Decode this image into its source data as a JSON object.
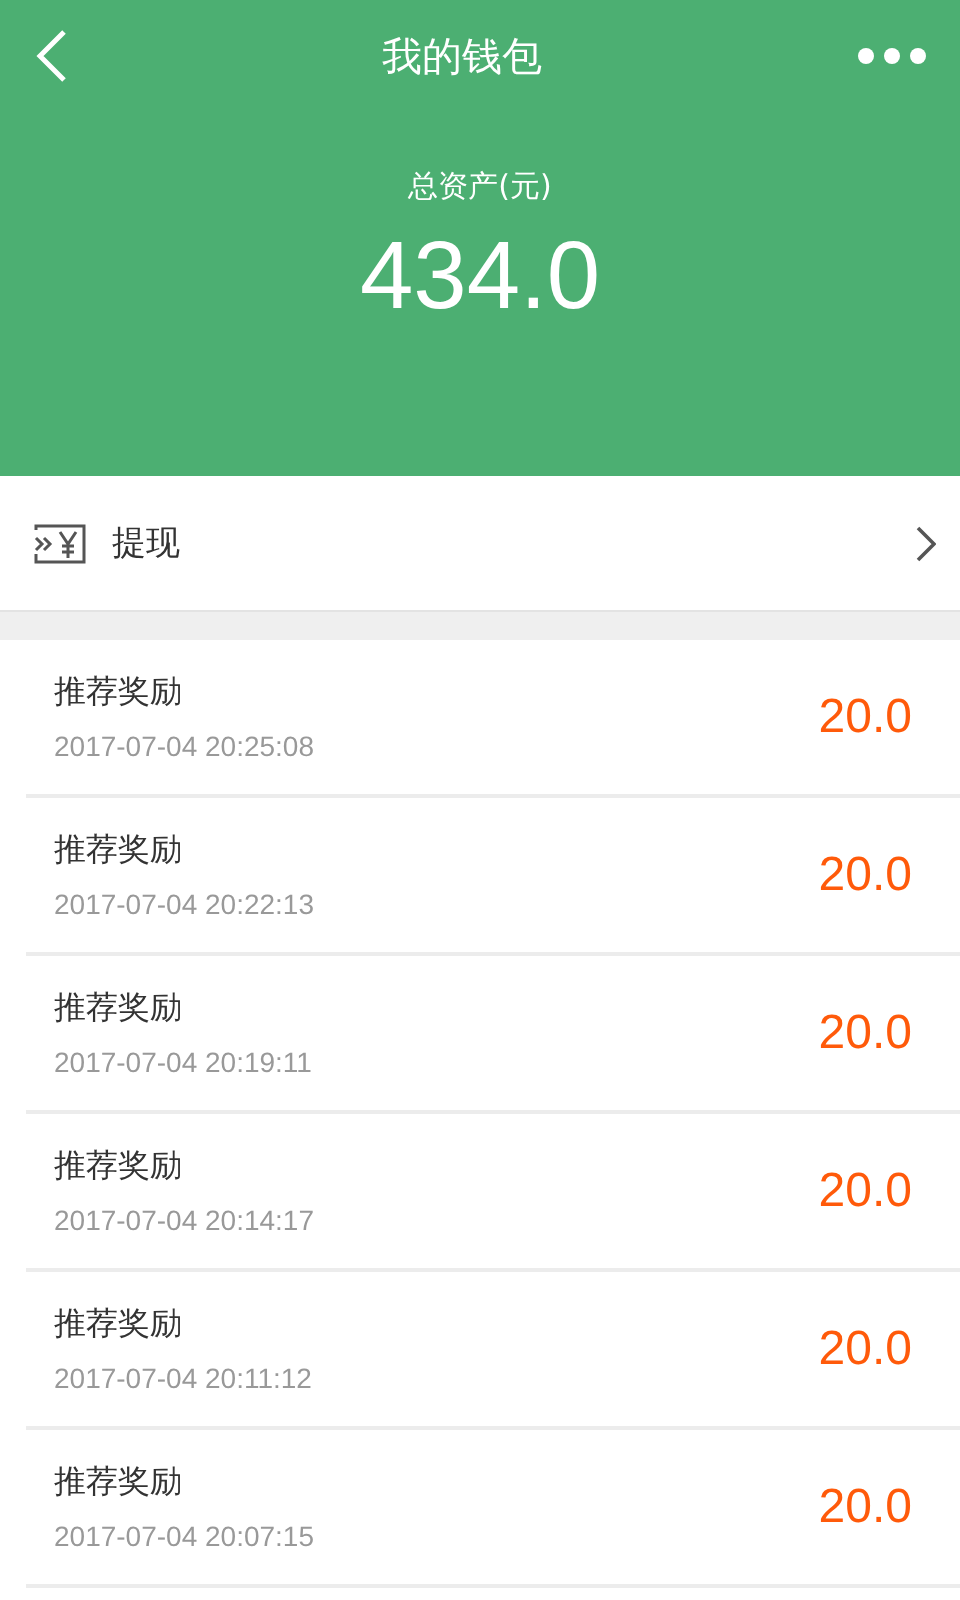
{
  "header": {
    "title": "我的钱包"
  },
  "summary": {
    "label": "总资产(元)",
    "amount": "434.0"
  },
  "withdraw": {
    "label": "提现"
  },
  "records": [
    {
      "title": "推荐奖励",
      "time": "2017-07-04 20:25:08",
      "amount": "20.0"
    },
    {
      "title": "推荐奖励",
      "time": "2017-07-04 20:22:13",
      "amount": "20.0"
    },
    {
      "title": "推荐奖励",
      "time": "2017-07-04 20:19:11",
      "amount": "20.0"
    },
    {
      "title": "推荐奖励",
      "time": "2017-07-04 20:14:17",
      "amount": "20.0"
    },
    {
      "title": "推荐奖励",
      "time": "2017-07-04 20:11:12",
      "amount": "20.0"
    },
    {
      "title": "推荐奖励",
      "time": "2017-07-04 20:07:15",
      "amount": "20.0"
    }
  ]
}
